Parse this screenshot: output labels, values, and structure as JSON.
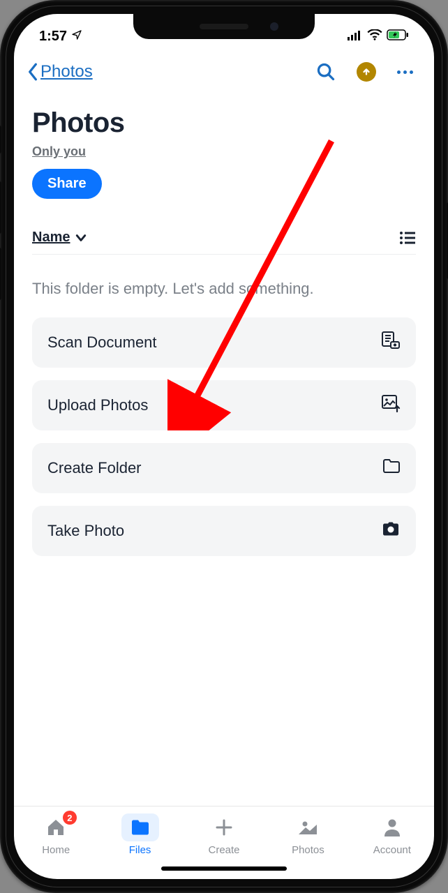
{
  "status": {
    "time": "1:57"
  },
  "nav": {
    "back_label": "Photos"
  },
  "page": {
    "title": "Photos",
    "access": "Only you",
    "share_label": "Share",
    "sort_label": "Name",
    "empty_text": "This folder is empty. Let's add something."
  },
  "actions": [
    {
      "label": "Scan Document",
      "icon": "scan"
    },
    {
      "label": "Upload Photos",
      "icon": "upload"
    },
    {
      "label": "Create Folder",
      "icon": "folder"
    },
    {
      "label": "Take Photo",
      "icon": "camera"
    }
  ],
  "tabs": {
    "home": "Home",
    "home_badge": "2",
    "files": "Files",
    "create": "Create",
    "photos": "Photos",
    "account": "Account"
  }
}
